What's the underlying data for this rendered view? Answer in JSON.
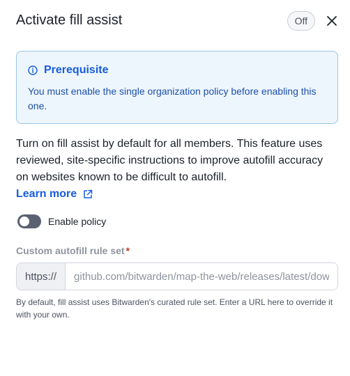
{
  "dialog": {
    "title": "Activate fill assist",
    "status": "Off"
  },
  "callout": {
    "title": "Prerequisite",
    "body": "You must enable the single organization policy before enabling this one."
  },
  "description": "Turn on fill assist by default for all members. This feature uses reviewed, site-specific instructions to improve autofill accuracy on websites known to be difficult to autofill.",
  "learn_more": "Learn more",
  "toggle": {
    "label": "Enable policy",
    "enabled": false
  },
  "rule_set": {
    "label": "Custom autofill rule set",
    "required_marker": "*",
    "prefix": "https://",
    "placeholder": "github.com/bitwarden/map-the-web/releases/latest/download/",
    "hint": "By default, fill assist uses Bitwarden's curated rule set. Enter a URL here to override it with your own."
  },
  "icons": {
    "close": "close-icon",
    "info": "info-icon",
    "external": "external-link-icon"
  }
}
